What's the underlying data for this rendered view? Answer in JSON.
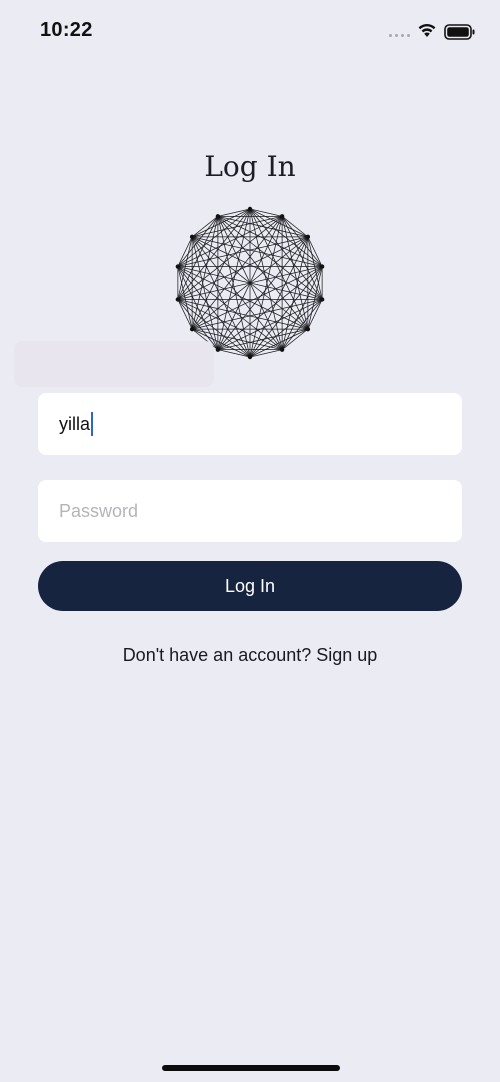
{
  "status_bar": {
    "time": "10:22",
    "icons": [
      "signal-dots-icon",
      "wifi-icon",
      "battery-icon"
    ]
  },
  "login": {
    "title": "Log In",
    "logo": "polygon-mesh-logo",
    "username_value": "yilla",
    "password_placeholder": "Password",
    "submit_label": "Log In",
    "signup_text": "Don't have an account? Sign up"
  },
  "colors": {
    "background": "#eaebf3",
    "button": "#172440",
    "field": "#ffffff",
    "caret": "#2f64c8"
  }
}
